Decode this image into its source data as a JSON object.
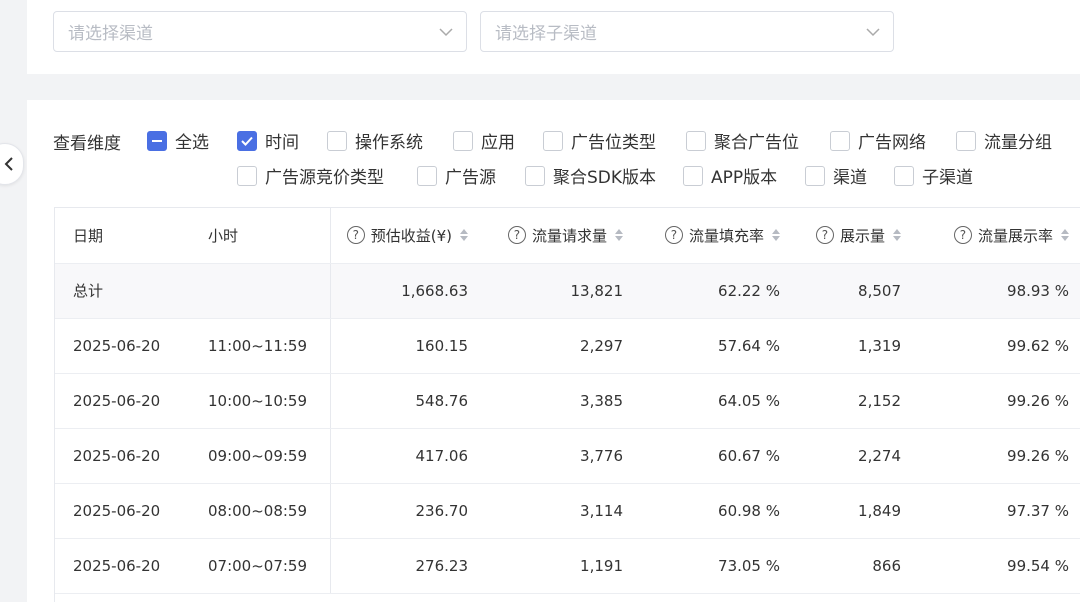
{
  "filters": {
    "channel_placeholder": "请选择渠道",
    "sub_channel_placeholder": "请选择子渠道"
  },
  "dimensions": {
    "label": "查看维度",
    "items": [
      {
        "label": "全选",
        "state": "indeterminate"
      },
      {
        "label": "时间",
        "state": "checked"
      },
      {
        "label": "操作系统",
        "state": "unchecked"
      },
      {
        "label": "应用",
        "state": "unchecked"
      },
      {
        "label": "广告位类型",
        "state": "unchecked"
      },
      {
        "label": "聚合广告位",
        "state": "unchecked"
      },
      {
        "label": "广告网络",
        "state": "unchecked"
      },
      {
        "label": "流量分组",
        "state": "unchecked"
      },
      {
        "label": "广告源竞价类型",
        "state": "unchecked"
      },
      {
        "label": "广告源",
        "state": "unchecked"
      },
      {
        "label": "聚合SDK版本",
        "state": "unchecked"
      },
      {
        "label": "APP版本",
        "state": "unchecked"
      },
      {
        "label": "渠道",
        "state": "unchecked"
      },
      {
        "label": "子渠道",
        "state": "unchecked"
      }
    ]
  },
  "table": {
    "columns": [
      "日期",
      "小时",
      "预估收益(¥)",
      "流量请求量",
      "流量填充率",
      "展示量",
      "流量展示率"
    ],
    "total": {
      "label": "总计",
      "revenue": "1,668.63",
      "requests": "13,821",
      "fill_rate": "62.22 %",
      "impressions": "8,507",
      "show_rate": "98.93 %"
    },
    "rows": [
      {
        "date": "2025-06-20",
        "hour": "11:00~11:59",
        "revenue": "160.15",
        "requests": "2,297",
        "fill_rate": "57.64 %",
        "impressions": "1,319",
        "show_rate": "99.62 %"
      },
      {
        "date": "2025-06-20",
        "hour": "10:00~10:59",
        "revenue": "548.76",
        "requests": "3,385",
        "fill_rate": "64.05 %",
        "impressions": "2,152",
        "show_rate": "99.26 %"
      },
      {
        "date": "2025-06-20",
        "hour": "09:00~09:59",
        "revenue": "417.06",
        "requests": "3,776",
        "fill_rate": "60.67 %",
        "impressions": "2,274",
        "show_rate": "99.26 %"
      },
      {
        "date": "2025-06-20",
        "hour": "08:00~08:59",
        "revenue": "236.70",
        "requests": "3,114",
        "fill_rate": "60.98 %",
        "impressions": "1,849",
        "show_rate": "97.37 %"
      },
      {
        "date": "2025-06-20",
        "hour": "07:00~07:59",
        "revenue": "276.23",
        "requests": "1,191",
        "fill_rate": "73.05 %",
        "impressions": "866",
        "show_rate": "99.54 %"
      }
    ]
  },
  "colors": {
    "accent": "#4a6fe3"
  }
}
